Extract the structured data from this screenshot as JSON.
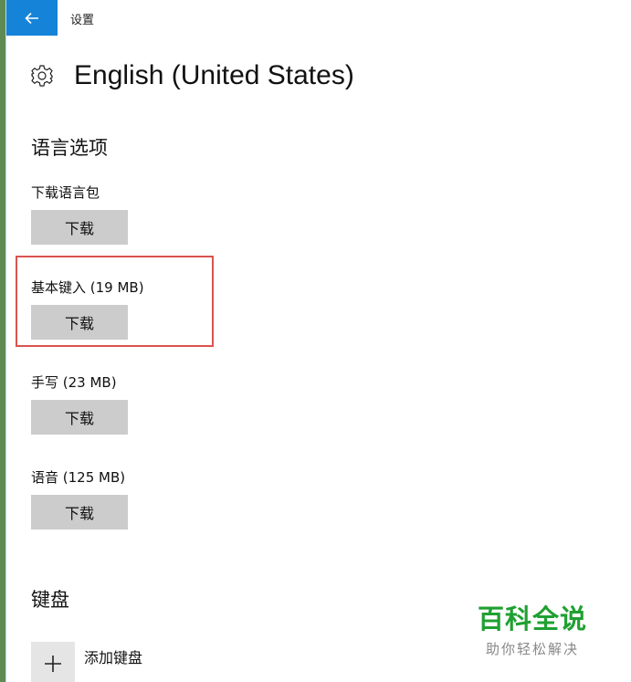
{
  "window": {
    "title": "设置"
  },
  "header": {
    "title": "English (United States)",
    "icon": "gear-icon"
  },
  "language_options": {
    "heading": "语言选项",
    "items": [
      {
        "label": "下载语言包",
        "button": "下载"
      },
      {
        "label": "基本键入 (19 MB)",
        "button": "下载"
      },
      {
        "label": "手写 (23 MB)",
        "button": "下载"
      },
      {
        "label": "语音 (125 MB)",
        "button": "下载"
      }
    ]
  },
  "keyboard": {
    "heading": "键盘",
    "add_label": "添加键盘"
  },
  "watermark": {
    "title": "百科全说",
    "subtitle": "助你轻松解决"
  },
  "colors": {
    "accent": "#1583d8",
    "button_bg": "#cccccc",
    "highlight": "#d9534f",
    "watermark": "#20a032"
  }
}
